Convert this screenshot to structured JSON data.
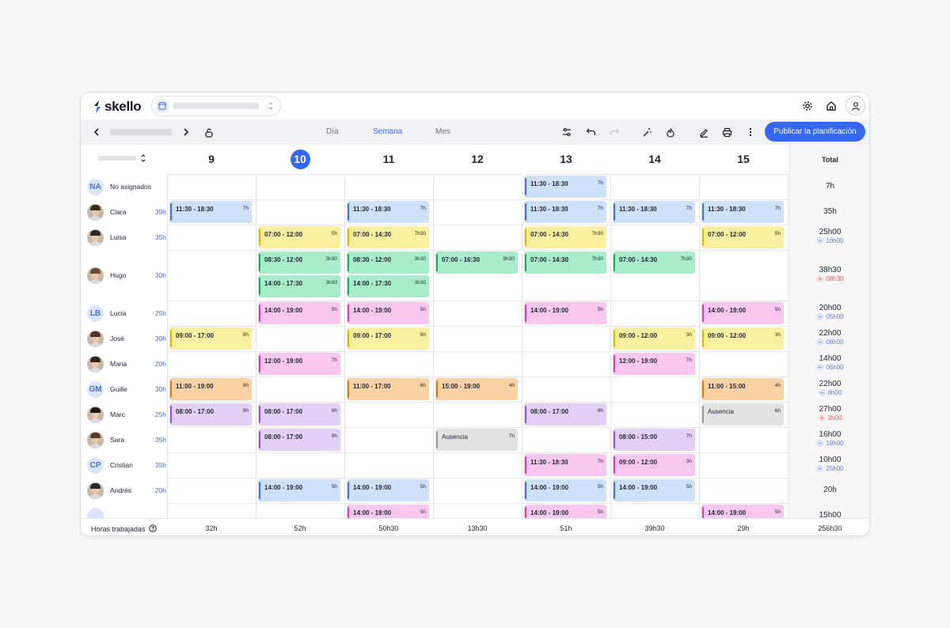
{
  "app": {
    "brand": "skello"
  },
  "toolbar": {
    "view_tabs": [
      {
        "label": "Día"
      },
      {
        "label": "Semana",
        "active": true
      },
      {
        "label": "Mes"
      }
    ],
    "publish_label": "Publicar la planificación"
  },
  "colors": {
    "accent": "#3467f4"
  },
  "week": {
    "days": [
      {
        "label": "9"
      },
      {
        "label": "10",
        "today": true
      },
      {
        "label": "11"
      },
      {
        "label": "12"
      },
      {
        "label": "13"
      },
      {
        "label": "14"
      },
      {
        "label": "15"
      }
    ],
    "total_header": "Total"
  },
  "employees": [
    {
      "name": "No asignados",
      "initials": "NA",
      "hours": "",
      "total": "7h",
      "diff": null
    },
    {
      "name": "Clara",
      "photo": true,
      "hours": "39h",
      "total": "35h",
      "diff": null
    },
    {
      "name": "Luisa",
      "photo": true,
      "hours": "35h",
      "total": "25h00",
      "diff": {
        "sign": "neg",
        "value": "10h00"
      }
    },
    {
      "name": "Hugo",
      "photo": true,
      "hours": "30h",
      "total": "38h30",
      "diff": {
        "sign": "pos",
        "value": "08h30"
      }
    },
    {
      "name": "Lucia",
      "initials": "LB",
      "hours": "25h",
      "total": "20h00",
      "diff": {
        "sign": "neg",
        "value": "05h00"
      }
    },
    {
      "name": "José",
      "photo": true,
      "hours": "30h",
      "total": "22h00",
      "diff": {
        "sign": "neg",
        "value": "08h00"
      }
    },
    {
      "name": "Maria",
      "photo": true,
      "hours": "20h",
      "total": "14h00",
      "diff": {
        "sign": "neg",
        "value": "06h00"
      }
    },
    {
      "name": "Guille",
      "initials": "GM",
      "hours": "30h",
      "total": "22h00",
      "diff": {
        "sign": "neg",
        "value": "8h00"
      }
    },
    {
      "name": "Marc",
      "photo": true,
      "hours": "25h",
      "total": "27h00",
      "diff": {
        "sign": "pos",
        "value": "2h00"
      }
    },
    {
      "name": "Sara",
      "photo": true,
      "hours": "35h",
      "total": "16h00",
      "diff": {
        "sign": "neg",
        "value": "19h00"
      }
    },
    {
      "name": "Cristian",
      "initials": "CP",
      "hours": "35h",
      "total": "10h00",
      "diff": {
        "sign": "neg",
        "value": "25h00"
      }
    },
    {
      "name": "Andrés",
      "photo": true,
      "hours": "20h",
      "total": "20h",
      "diff": null
    },
    {
      "name": "",
      "initials": "",
      "hours": "",
      "total": "15h00",
      "diff": null
    }
  ],
  "shift_colors": {
    "blue": {
      "bg": "#cfe0fb",
      "bar": "#3f6ff5"
    },
    "yellow": {
      "bg": "#fbf0a0",
      "bar": "#e1b400"
    },
    "green": {
      "bg": "#a8ecc9",
      "bar": "#1fa865"
    },
    "pink": {
      "bg": "#f9c7f0",
      "bar": "#d63dbb"
    },
    "orange": {
      "bg": "#fbd2a6",
      "bar": "#e07a10"
    },
    "purple": {
      "bg": "#e3d0f7",
      "bar": "#9a4fd8"
    },
    "gray": {
      "bg": "#e2e2e2",
      "bar": "#9a9a9a"
    }
  },
  "shifts": [
    {
      "row": 0,
      "day": 4,
      "time": "11:30 - 18:30",
      "dur": "7h",
      "color": "blue"
    },
    {
      "row": 1,
      "day": 0,
      "time": "11:30 - 18:30",
      "dur": "7h",
      "color": "blue"
    },
    {
      "row": 1,
      "day": 2,
      "time": "11:30 - 18:30",
      "dur": "7h",
      "color": "blue"
    },
    {
      "row": 1,
      "day": 4,
      "time": "11:30 - 18:30",
      "dur": "7h",
      "color": "blue"
    },
    {
      "row": 1,
      "day": 5,
      "time": "11:30 - 18:30",
      "dur": "7h",
      "color": "blue"
    },
    {
      "row": 1,
      "day": 6,
      "time": "11:30 - 18:30",
      "dur": "7h",
      "color": "blue"
    },
    {
      "row": 2,
      "day": 1,
      "time": "07:00 - 12:00",
      "dur": "5h",
      "color": "yellow"
    },
    {
      "row": 2,
      "day": 2,
      "time": "07:00 - 14:30",
      "dur": "7h30",
      "color": "yellow"
    },
    {
      "row": 2,
      "day": 4,
      "time": "07:00 - 14:30",
      "dur": "7h30",
      "color": "yellow"
    },
    {
      "row": 2,
      "day": 6,
      "time": "07:00 - 12:00",
      "dur": "5h",
      "color": "yellow"
    },
    {
      "row": 3,
      "sub": 0,
      "day": 1,
      "time": "08:30 - 12:00",
      "dur": "3h30",
      "color": "green"
    },
    {
      "row": 3,
      "sub": 1,
      "day": 1,
      "time": "14:00 - 17:30",
      "dur": "3h30",
      "color": "green"
    },
    {
      "row": 3,
      "sub": 0,
      "day": 2,
      "time": "08:30 - 12:00",
      "dur": "3h30",
      "color": "green"
    },
    {
      "row": 3,
      "sub": 1,
      "day": 2,
      "time": "14:00 - 17:30",
      "dur": "3h30",
      "color": "green"
    },
    {
      "row": 3,
      "sub": 0,
      "day": 3,
      "time": "07:00 - 16:30",
      "dur": "9h30",
      "color": "green"
    },
    {
      "row": 3,
      "sub": 0,
      "day": 4,
      "time": "07:00 - 14:30",
      "dur": "7h30",
      "color": "green"
    },
    {
      "row": 3,
      "sub": 0,
      "day": 5,
      "time": "07:00 - 14:30",
      "dur": "7h30",
      "color": "green"
    },
    {
      "row": 4,
      "day": 1,
      "time": "14:00 - 19:00",
      "dur": "5h",
      "color": "pink"
    },
    {
      "row": 4,
      "day": 2,
      "time": "14:00 - 19:00",
      "dur": "5h",
      "color": "pink"
    },
    {
      "row": 4,
      "day": 4,
      "time": "14:00 - 19:00",
      "dur": "5h",
      "color": "pink"
    },
    {
      "row": 4,
      "day": 6,
      "time": "14:00 - 19:00",
      "dur": "5h",
      "color": "pink"
    },
    {
      "row": 5,
      "day": 0,
      "time": "09:00 - 17:00",
      "dur": "8h",
      "color": "yellow"
    },
    {
      "row": 5,
      "day": 2,
      "time": "09:00 - 17:00",
      "dur": "8h",
      "color": "yellow"
    },
    {
      "row": 5,
      "day": 5,
      "time": "09:00 - 12:00",
      "dur": "3h",
      "color": "yellow"
    },
    {
      "row": 5,
      "day": 6,
      "time": "09:00 - 12:00",
      "dur": "3h",
      "color": "yellow"
    },
    {
      "row": 6,
      "day": 1,
      "time": "12:00 - 19:00",
      "dur": "7h",
      "color": "pink"
    },
    {
      "row": 6,
      "day": 5,
      "time": "12:00 - 19:00",
      "dur": "7h",
      "color": "pink"
    },
    {
      "row": 7,
      "day": 0,
      "time": "11:00 - 19:00",
      "dur": "8h",
      "color": "orange"
    },
    {
      "row": 7,
      "day": 2,
      "time": "11:00 - 17:00",
      "dur": "6h",
      "color": "orange"
    },
    {
      "row": 7,
      "day": 3,
      "time": "15:00 - 19:00",
      "dur": "4h",
      "color": "orange"
    },
    {
      "row": 7,
      "day": 6,
      "time": "11:00 - 15:00",
      "dur": "4h",
      "color": "orange"
    },
    {
      "row": 8,
      "day": 0,
      "time": "08:00 - 17:00",
      "dur": "9h",
      "color": "purple"
    },
    {
      "row": 8,
      "day": 1,
      "time": "08:00 - 17:00",
      "dur": "9h",
      "color": "purple"
    },
    {
      "row": 8,
      "day": 4,
      "time": "08:00 - 17:00",
      "dur": "9h",
      "color": "purple"
    },
    {
      "row": 8,
      "day": 6,
      "time": "Ausencia",
      "dur": "6h",
      "color": "gray",
      "absence": true
    },
    {
      "row": 9,
      "day": 1,
      "time": "08:00 - 17:00",
      "dur": "9h",
      "color": "purple"
    },
    {
      "row": 9,
      "day": 3,
      "time": "Ausencia",
      "dur": "7h",
      "color": "gray",
      "absence": true
    },
    {
      "row": 9,
      "day": 5,
      "time": "08:00 - 15:00",
      "dur": "7h",
      "color": "purple"
    },
    {
      "row": 10,
      "day": 4,
      "time": "11:30 - 18:30",
      "dur": "7h",
      "color": "pink"
    },
    {
      "row": 10,
      "day": 5,
      "time": "09:00 - 12:00",
      "dur": "3h",
      "color": "pink"
    },
    {
      "row": 11,
      "day": 1,
      "time": "14:00 - 19:00",
      "dur": "5h",
      "color": "blue"
    },
    {
      "row": 11,
      "day": 2,
      "time": "14:00 - 19:00",
      "dur": "5h",
      "color": "blue"
    },
    {
      "row": 11,
      "day": 4,
      "time": "14:00 - 19:00",
      "dur": "5h",
      "color": "blue"
    },
    {
      "row": 11,
      "day": 5,
      "time": "14:00 - 19:00",
      "dur": "5h",
      "color": "blue"
    },
    {
      "row": 12,
      "day": 2,
      "time": "14:00 - 19:00",
      "dur": "5h",
      "color": "pink"
    },
    {
      "row": 12,
      "day": 4,
      "time": "14:00 - 19:00",
      "dur": "5h",
      "color": "pink"
    },
    {
      "row": 12,
      "day": 6,
      "time": "14:00 - 19:00",
      "dur": "5h",
      "color": "pink"
    }
  ],
  "footer": {
    "label": "Horas trabajadas",
    "day_totals": [
      "32h",
      "52h",
      "50h30",
      "13h30",
      "51h",
      "39h30",
      "29h"
    ],
    "grand_total": "256h30"
  }
}
